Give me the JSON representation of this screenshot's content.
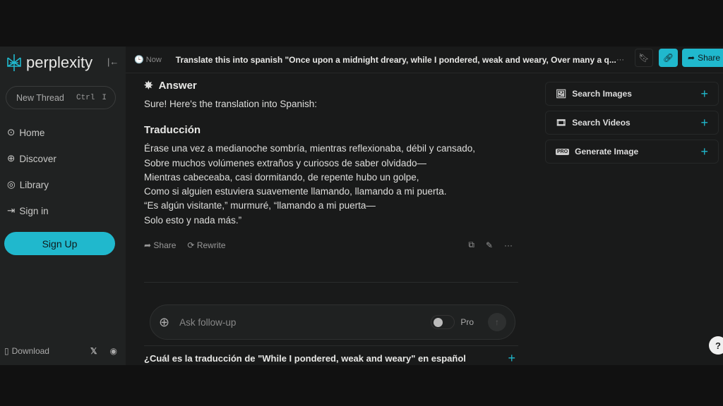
{
  "brand": {
    "name": "perplexity",
    "accent": "#20b8cd"
  },
  "sidebar": {
    "new_thread": "New Thread",
    "shortcut": [
      "Ctrl",
      "I"
    ],
    "items": [
      {
        "label": "Home",
        "icon": "search-icon"
      },
      {
        "label": "Discover",
        "icon": "globe-icon"
      },
      {
        "label": "Library",
        "icon": "library-icon"
      },
      {
        "label": "Sign in",
        "icon": "sign-in-icon"
      }
    ],
    "signup": "Sign Up",
    "download": "Download"
  },
  "topbar": {
    "time": "Now",
    "title": "Translate this into spanish \"Once upon a midnight dreary, while I pondered, weak and weary, Over many a q...",
    "share": "Share"
  },
  "answer": {
    "heading": "Answer",
    "intro": "Sure! Here's the translation into Spanish:",
    "subheading": "Traducción",
    "lines": [
      "Érase una vez a medianoche sombría, mientras reflexionaba, débil y cansado,",
      "Sobre muchos volúmenes extraños y curiosos de saber olvidado—",
      "Mientras cabeceaba, casi dormitando, de repente hubo un golpe,",
      "Como si alguien estuviera suavemente llamando, llamando a mi puerta.",
      "“Es algún visitante,” murmuré, “llamando a mi puerta—",
      "Solo esto y nada más.”"
    ],
    "share": "Share",
    "rewrite": "Rewrite"
  },
  "right_panel": [
    {
      "label": "Search Images",
      "icon": "image-icon"
    },
    {
      "label": "Search Videos",
      "icon": "film-icon"
    },
    {
      "label": "Generate Image",
      "icon": "pro-badge-icon"
    }
  ],
  "followup": {
    "placeholder": "Ask follow-up",
    "pro": "Pro"
  },
  "related": {
    "item": "¿Cuál es la traducción de \"While I pondered, weak and weary\" en español"
  },
  "help": "?"
}
